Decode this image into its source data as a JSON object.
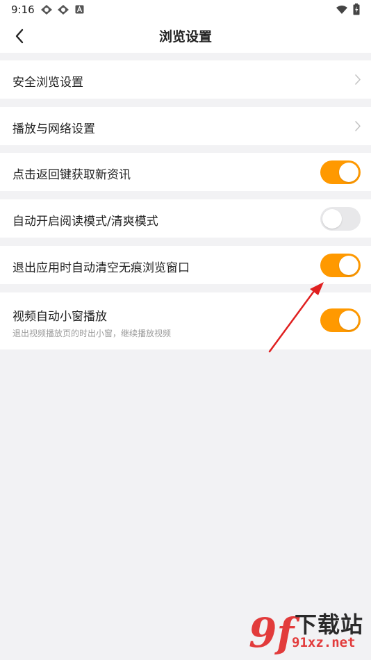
{
  "status_bar": {
    "time": "9:16"
  },
  "header": {
    "title": "浏览设置"
  },
  "settings": [
    {
      "label": "安全浏览设置",
      "control": "chevron"
    },
    {
      "label": "播放与网络设置",
      "control": "chevron"
    },
    {
      "label": "点击返回键获取新资讯",
      "control": "toggle",
      "enabled": true
    },
    {
      "label": "自动开启阅读模式/清爽模式",
      "control": "toggle",
      "enabled": false
    },
    {
      "label": "退出应用时自动清空无痕浏览窗口",
      "control": "toggle",
      "enabled": true
    },
    {
      "label": "视频自动小窗播放",
      "description": "退出视频播放页的时出小窗，继续播放视频",
      "control": "toggle",
      "enabled": true
    }
  ],
  "watermark": {
    "mark": "9f",
    "name": "下载站",
    "domain": "91xz.net"
  },
  "colors": {
    "accent": "#ff9900",
    "annotation_arrow": "#e02020",
    "watermark_red": "#e23b3b"
  }
}
